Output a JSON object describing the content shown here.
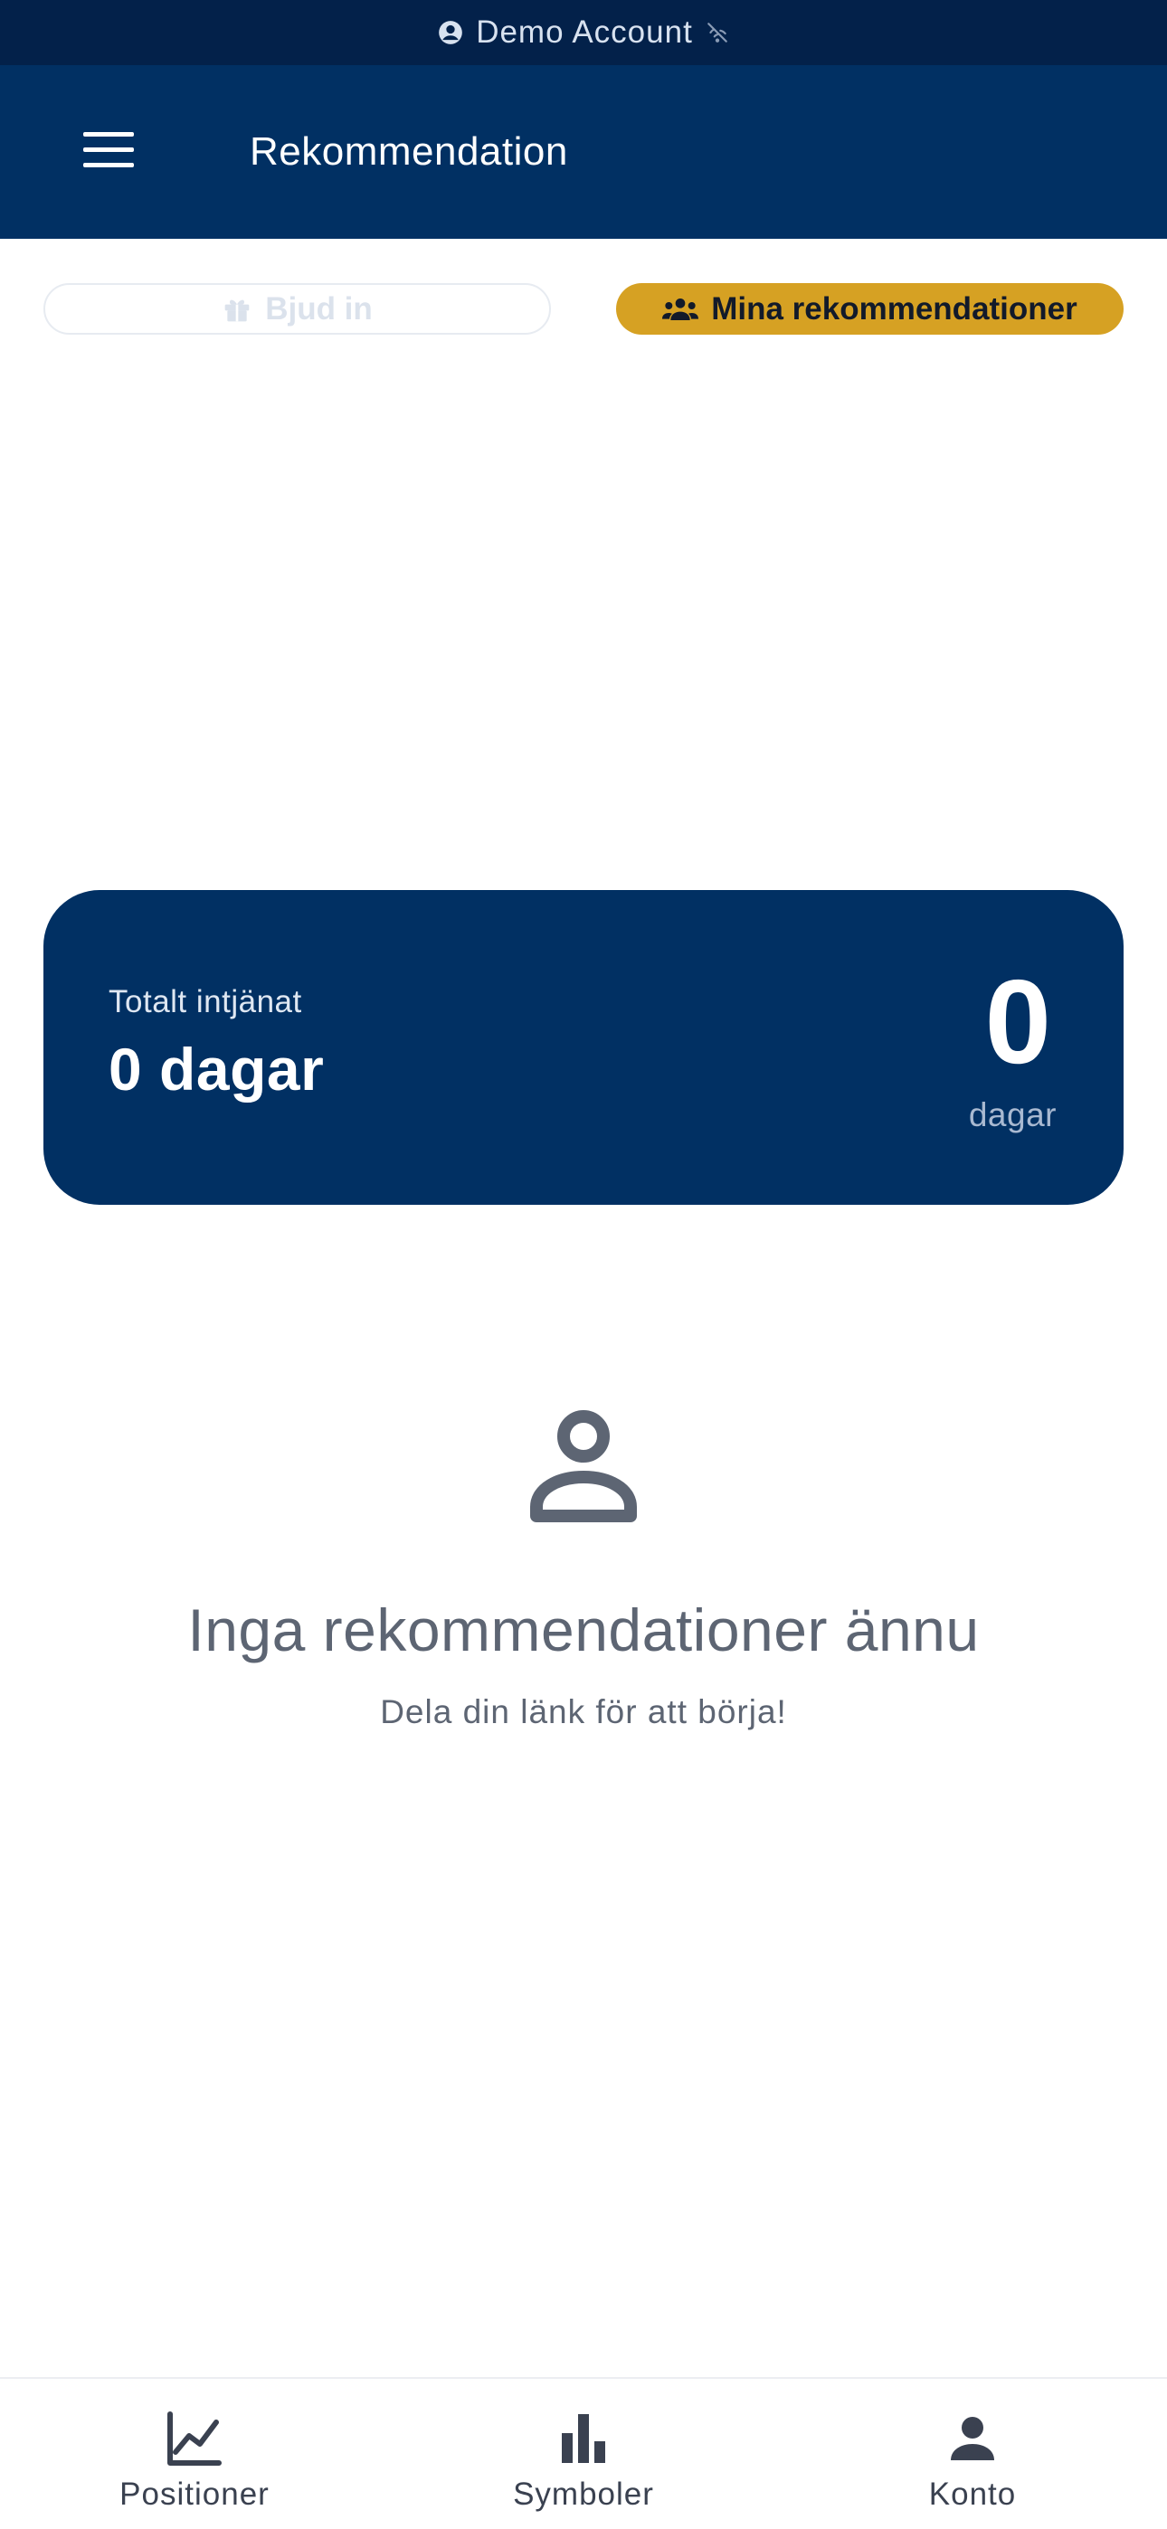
{
  "demo_banner": {
    "account_label": "Demo Account",
    "left_icon": "account-circle-icon",
    "right_icon": "signal-off-icon"
  },
  "app_bar": {
    "title": "Rekommendation",
    "menu_icon": "hamburger-menu-icon"
  },
  "tabs": [
    {
      "label": "Bjud in",
      "icon": "gift-icon",
      "active": false
    },
    {
      "label": "Mina rekommendationer",
      "icon": "group-icon",
      "active": true
    }
  ],
  "earned_card": {
    "label": "Totalt intjänat",
    "value": "0 dagar",
    "big_number": "0",
    "unit": "dagar"
  },
  "empty_state": {
    "icon": "person-outline-icon",
    "title": "Inga rekommendationer ännu",
    "subtitle": "Dela din länk för att börja!"
  },
  "bottom_nav": [
    {
      "label": "Positioner",
      "icon": "line-chart-icon"
    },
    {
      "label": "Symboler",
      "icon": "bar-chart-icon"
    },
    {
      "label": "Konto",
      "icon": "person-icon"
    }
  ],
  "colors": {
    "banner_bg": "#03214a",
    "primary": "#013063",
    "accent": "#d6a123",
    "text_muted": "#5d6573"
  }
}
